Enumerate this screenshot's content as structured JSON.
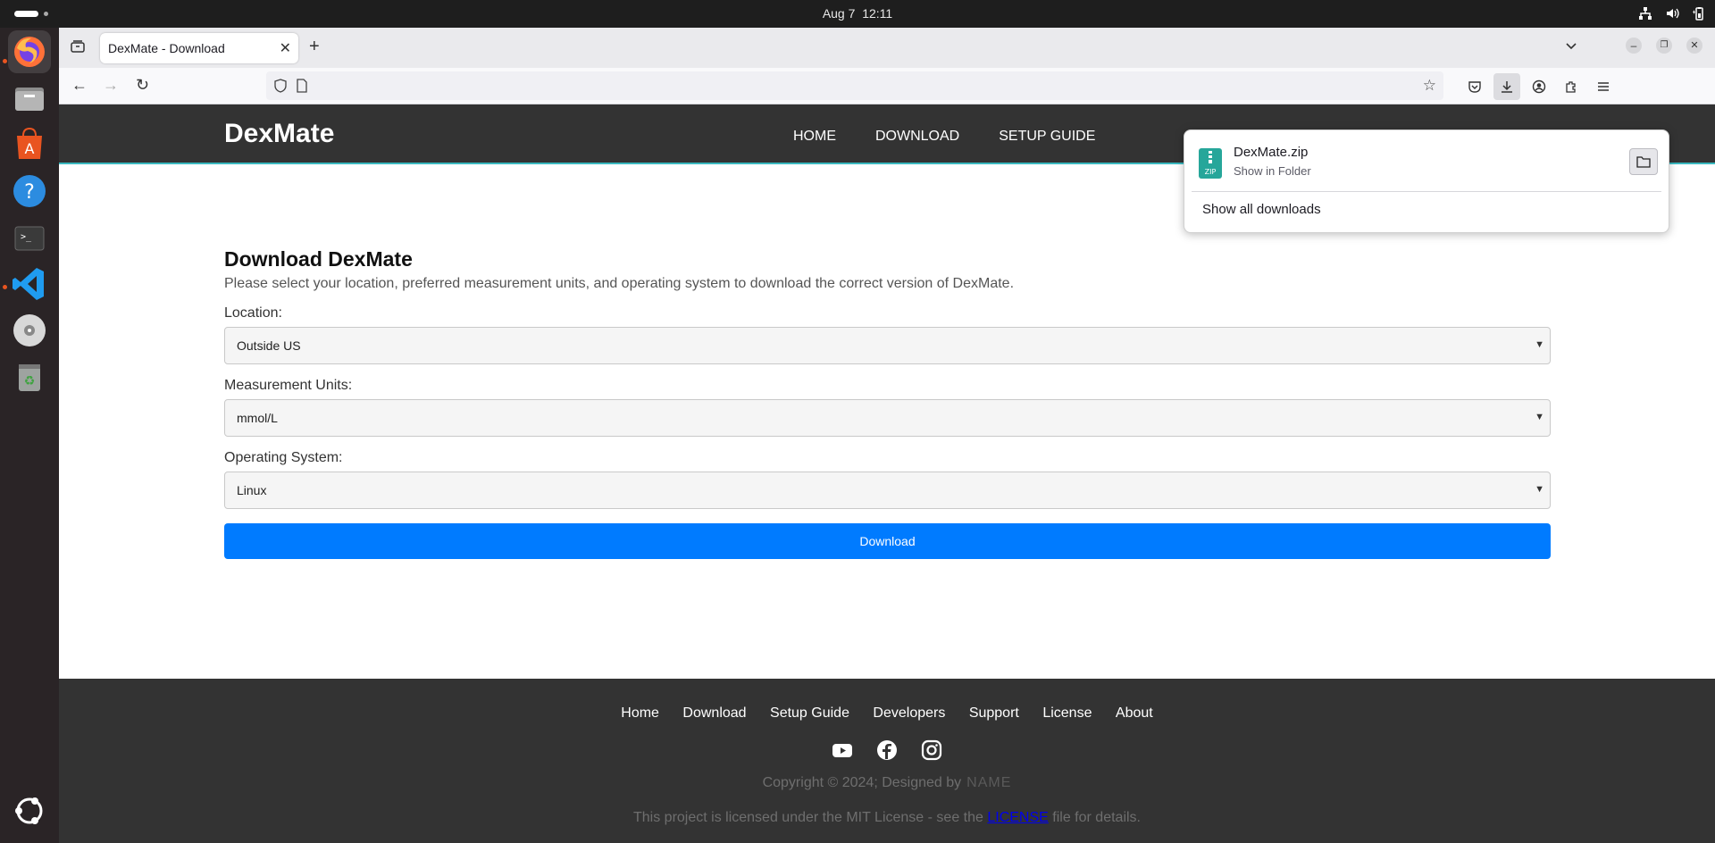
{
  "system": {
    "date": "Aug 7",
    "time": "12:11"
  },
  "dock": {
    "items": [
      "firefox-icon",
      "files-icon",
      "app-center-icon",
      "help-icon",
      "terminal-icon",
      "vscode-icon",
      "dvd-icon",
      "trash-icon",
      "ubuntu-logo-icon"
    ]
  },
  "browser": {
    "tab_title": "DexMate - Download",
    "url": "",
    "downloads_panel": {
      "file_name": "DexMate.zip",
      "file_status": "Show in Folder",
      "show_all": "Show all downloads"
    }
  },
  "site": {
    "logo": "DexMate",
    "nav": [
      "HOME",
      "DOWNLOAD",
      "SETUP GUIDE"
    ],
    "heading": "Download DexMate",
    "lead": "Please select your location, preferred measurement units, and operating system to download the correct version of DexMate.",
    "location_label": "Location:",
    "location_value": "Outside US",
    "units_label": "Measurement Units:",
    "units_value": "mmol/L",
    "os_label": "Operating System:",
    "os_value": "Linux",
    "download_button": "Download"
  },
  "footer": {
    "links": [
      "Home",
      "Download",
      "Setup Guide",
      "Developers",
      "Support",
      "License",
      "About"
    ],
    "social": [
      "youtube-icon",
      "facebook-icon",
      "instagram-icon"
    ],
    "copyright": "Copyright © 2024; Designed by",
    "designer": "NAME",
    "license_prefix": "This project is licensed under the MIT License - see the",
    "license_link": "LICENSE",
    "license_suffix": "file for details."
  }
}
